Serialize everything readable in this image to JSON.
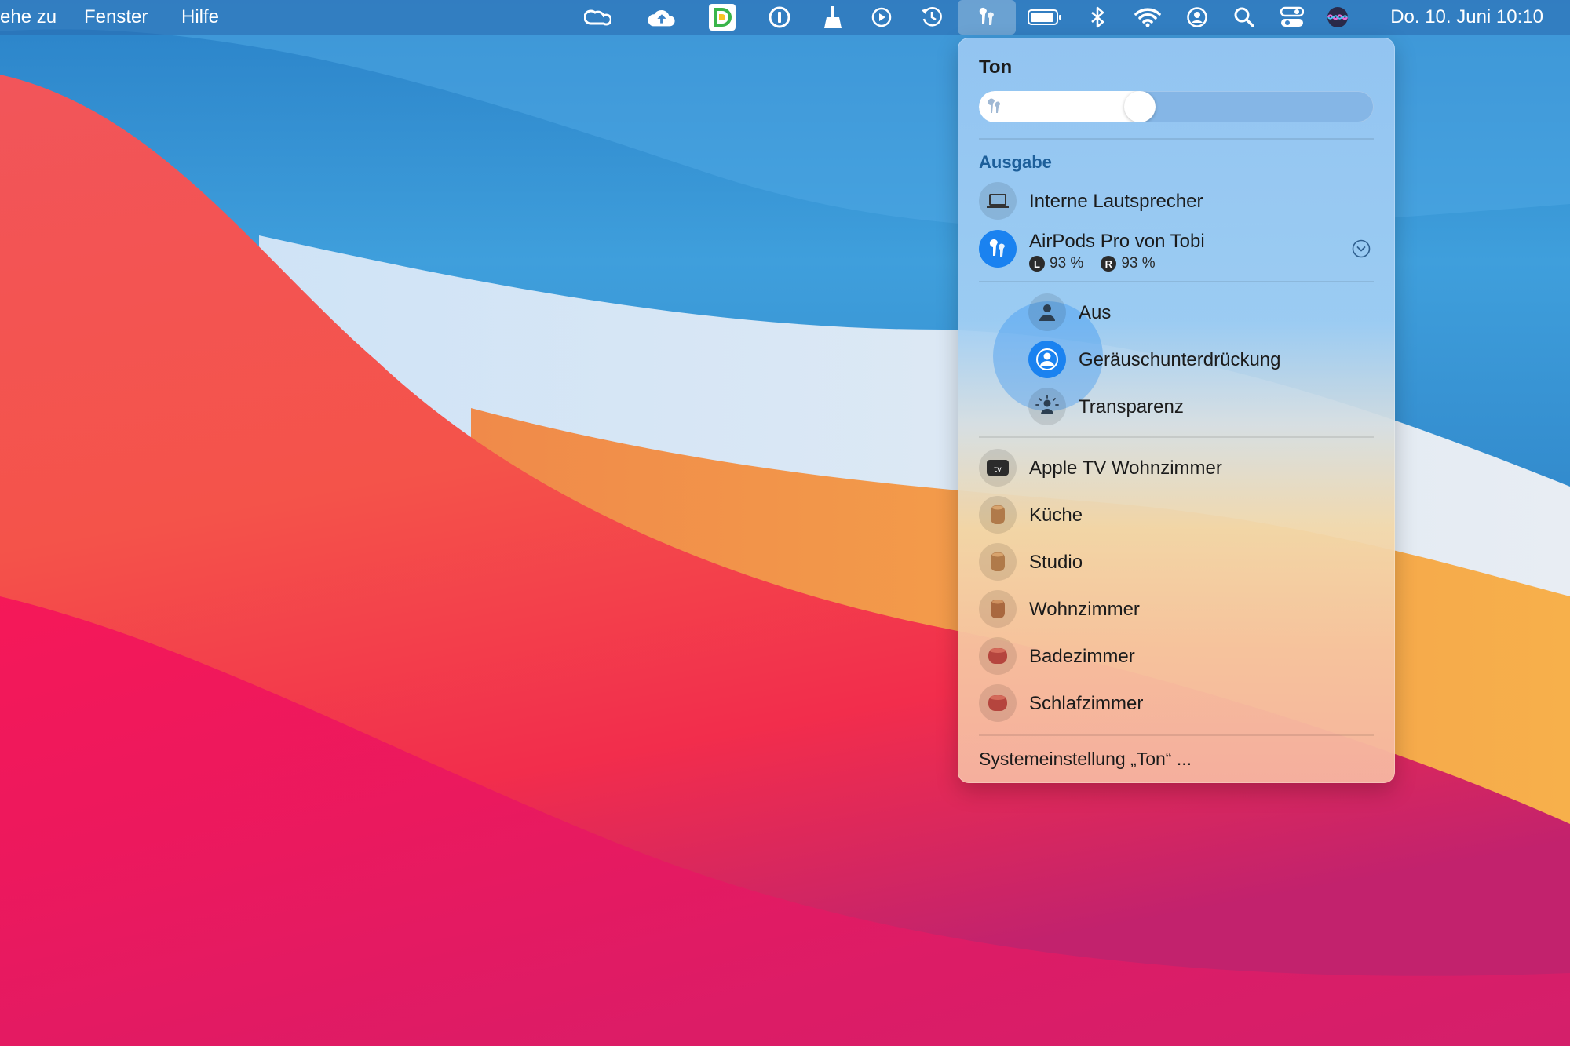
{
  "menubar": {
    "menus": [
      "ehe zu",
      "Fenster",
      "Hilfe"
    ],
    "status_icons": [
      "creative-cloud-icon",
      "cloud-upload-icon",
      "dictionary-app-icon",
      "onepassword-icon",
      "cleaner-icon",
      "play-circle-icon",
      "time-machine-icon",
      "airpods-icon",
      "battery-icon",
      "bluetooth-icon",
      "wifi-icon",
      "user-account-icon",
      "spotlight-search-icon",
      "control-center-icon",
      "siri-icon"
    ],
    "clock": "Do. 10. Juni  10:10"
  },
  "sound_menu": {
    "title": "Ton",
    "volume": 0.4,
    "output_label": "Ausgabe",
    "internal_speaker": "Interne Lautsprecher",
    "airpods": {
      "name": "AirPods Pro von Tobi",
      "left_badge": "L",
      "left_battery": "93 %",
      "right_badge": "R",
      "right_battery": "93 %"
    },
    "noise_modes": [
      "Aus",
      "Geräuschunterdrückung",
      "Transparenz"
    ],
    "selected_mode": "Geräuschunterdrückung",
    "other_devices": [
      "Apple TV Wohnzimmer",
      "Küche",
      "Studio",
      "Wohnzimmer",
      "Badezimmer",
      "Schlafzimmer"
    ],
    "settings_link": "Systemeinstellung „Ton“ ..."
  },
  "colors": {
    "accent": "#1a82f0",
    "section_label": "#1d5f9a",
    "homepod_mini": "#b07a4a",
    "homepod_red": "#b5453e"
  }
}
